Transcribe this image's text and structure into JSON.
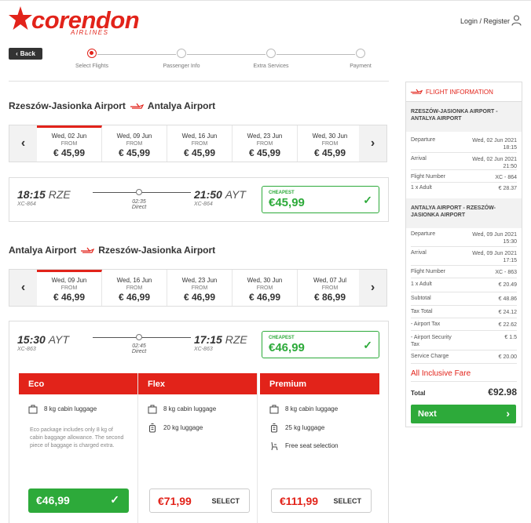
{
  "brand": {
    "name": "corendon",
    "sub": "AIRLINES",
    "accent": "#e2231a",
    "green": "#2daa3a"
  },
  "header": {
    "login_label": "Login / Register",
    "user_icon": "user-icon"
  },
  "nav": {
    "back_label": "Back"
  },
  "steps": [
    {
      "label": "Select Flights",
      "active": true
    },
    {
      "label": "Passenger Info",
      "active": false
    },
    {
      "label": "Extra Services",
      "active": false
    },
    {
      "label": "Payment",
      "active": false
    }
  ],
  "outbound": {
    "from": "Rzeszów-Jasionka Airport",
    "to": "Antalya Airport",
    "dates": [
      {
        "date": "Wed, 02 Jun",
        "from_label": "FROM",
        "price": "€ 45,99",
        "selected": true
      },
      {
        "date": "Wed, 09 Jun",
        "from_label": "FROM",
        "price": "€ 45,99",
        "selected": false
      },
      {
        "date": "Wed, 16 Jun",
        "from_label": "FROM",
        "price": "€ 45,99",
        "selected": false
      },
      {
        "date": "Wed, 23 Jun",
        "from_label": "FROM",
        "price": "€ 45,99",
        "selected": false
      },
      {
        "date": "Wed, 30 Jun",
        "from_label": "FROM",
        "price": "€ 45,99",
        "selected": false
      }
    ],
    "flight": {
      "dep_time": "18:15",
      "dep_code": "RZE",
      "dep_flight": "XC-864",
      "arr_time": "21:50",
      "arr_code": "AYT",
      "arr_flight": "XC-864",
      "duration": "02:35",
      "stops": "Direct",
      "cheapest_label": "CHEAPEST",
      "cheapest_price": "€45,99"
    }
  },
  "inbound": {
    "from": "Antalya Airport",
    "to": "Rzeszów-Jasionka Airport",
    "dates": [
      {
        "date": "Wed, 09 Jun",
        "from_label": "FROM",
        "price": "€ 46,99",
        "selected": true
      },
      {
        "date": "Wed, 16 Jun",
        "from_label": "FROM",
        "price": "€ 46,99",
        "selected": false
      },
      {
        "date": "Wed, 23 Jun",
        "from_label": "FROM",
        "price": "€ 46,99",
        "selected": false
      },
      {
        "date": "Wed, 30 Jun",
        "from_label": "FROM",
        "price": "€ 46,99",
        "selected": false
      },
      {
        "date": "Wed, 07 Jul",
        "from_label": "FROM",
        "price": "€ 86,99",
        "selected": false
      }
    ],
    "flight": {
      "dep_time": "15:30",
      "dep_code": "AYT",
      "dep_flight": "XC-863",
      "arr_time": "17:15",
      "arr_code": "RZE",
      "arr_flight": "XC-863",
      "duration": "02:45",
      "stops": "Direct",
      "cheapest_label": "CHEAPEST",
      "cheapest_price": "€46,99"
    }
  },
  "fares": [
    {
      "name": "Eco",
      "features": [
        {
          "icon": "cabin-bag-icon",
          "text": "8 kg cabin luggage"
        }
      ],
      "note": "Eco package includes only 8 kg of cabin baggage allowance. The second piece of baggage is charged extra.",
      "price": "€46,99",
      "selected": true,
      "button_label": ""
    },
    {
      "name": "Flex",
      "features": [
        {
          "icon": "cabin-bag-icon",
          "text": "8 kg cabin luggage"
        },
        {
          "icon": "suitcase-icon",
          "text": "20 kg luggage"
        }
      ],
      "note": "",
      "price": "€71,99",
      "selected": false,
      "button_label": "SELECT"
    },
    {
      "name": "Premium",
      "features": [
        {
          "icon": "cabin-bag-icon",
          "text": "8 kg cabin luggage"
        },
        {
          "icon": "suitcase-icon",
          "text": "25 kg luggage"
        },
        {
          "icon": "seat-icon",
          "text": "Free seat selection"
        }
      ],
      "note": "",
      "price": "€111,99",
      "selected": false,
      "button_label": "SELECT"
    }
  ],
  "sidebar": {
    "title": "FLIGHT INFORMATION",
    "outbound": {
      "route": "RZESZÓW-JASIONKA AIRPORT - ANTALYA AIRPORT",
      "rows": [
        {
          "k": "Departure",
          "v": "Wed, 02 Jun 2021 18:15"
        },
        {
          "k": "Arrival",
          "v": "Wed, 02 Jun 2021 21:50"
        },
        {
          "k": "Flight Number",
          "v": "XC - 864"
        },
        {
          "k": "1 x Adult",
          "v": "€ 28.37"
        }
      ]
    },
    "inbound": {
      "route": "ANTALYA AIRPORT - RZESZÓW-JASIONKA AIRPORT",
      "rows": [
        {
          "k": "Departure",
          "v": "Wed, 09 Jun 2021 15:30"
        },
        {
          "k": "Arrival",
          "v": "Wed, 09 Jun 2021 17:15"
        },
        {
          "k": "Flight Number",
          "v": "XC - 863"
        },
        {
          "k": "1 x Adult",
          "v": "€ 20.49"
        }
      ]
    },
    "summary": [
      {
        "k": "Subtotal",
        "v": "€ 48.86"
      },
      {
        "k": "Tax Total",
        "v": "€ 24.12"
      },
      {
        "k": "- Airport Tax",
        "v": "€ 22.62"
      },
      {
        "k": "- Airport Security Tax",
        "v": "€ 1.5"
      },
      {
        "k": "Service Charge",
        "v": "€ 20.00"
      }
    ],
    "fare_name": "All Inclusive Fare",
    "total_label": "Total",
    "total_value": "€92.98",
    "next_label": "Next"
  }
}
